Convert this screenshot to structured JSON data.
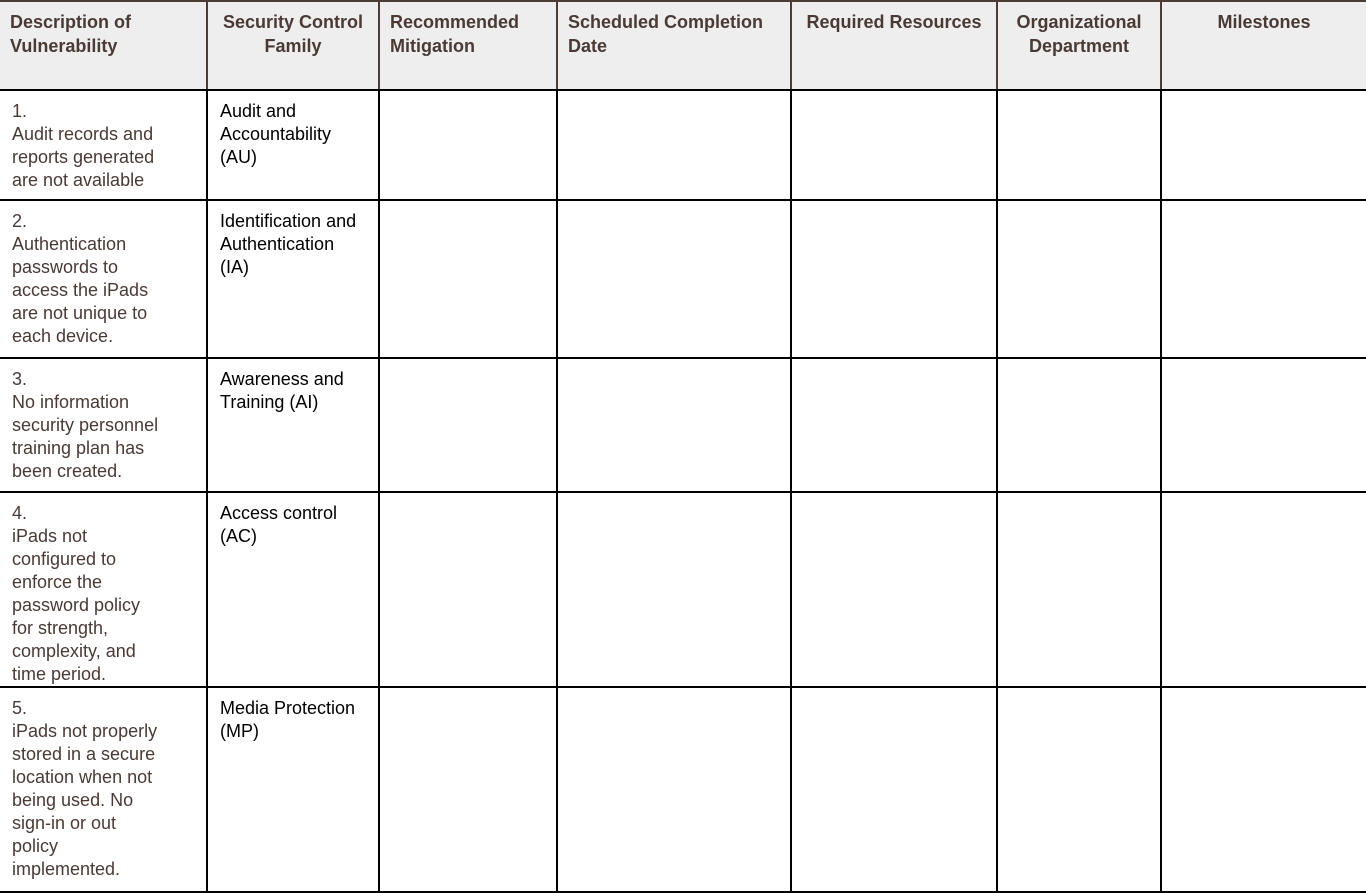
{
  "headers": [
    "Description of Vulnerability",
    "Security Control Family",
    "Recommended Mitigation",
    "Scheduled Completion Date",
    "Required Resources",
    "Organizational Department",
    "Milestones"
  ],
  "rows": [
    {
      "num": "1.",
      "description": "Audit records and reports generated are not available",
      "family": "Audit and Accountability (AU)"
    },
    {
      "num": "2.",
      "description": "Authentication passwords to access the iPads are not unique to each device.",
      "family": "Identification and Authentication (IA)"
    },
    {
      "num": "3.",
      "description": "No information security personnel training plan has been created.",
      "family": "Awareness and Training (AI)"
    },
    {
      "num": "4.",
      "description": "iPads not configured to enforce the password policy for strength, complexity, and time period.",
      "family": "Access control (AC)"
    },
    {
      "num": "5.",
      "description": "iPads not properly stored in a secure location when not being used. No sign-in or out policy implemented.",
      "family": "Media Protection (MP)"
    }
  ]
}
